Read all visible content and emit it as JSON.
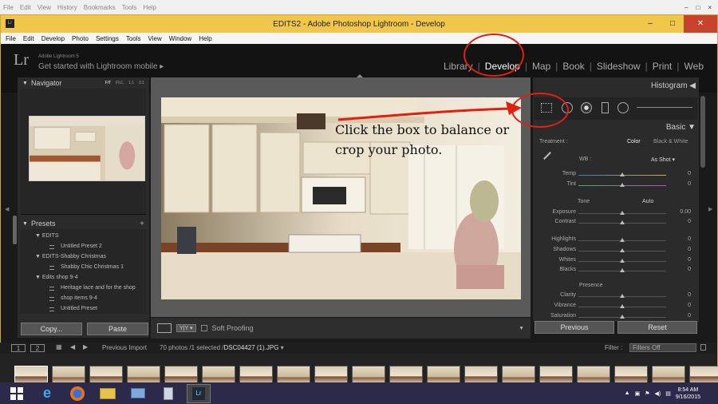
{
  "background_menu": [
    "File",
    "Edit",
    "View",
    "History",
    "Bookmarks",
    "Tools",
    "Help"
  ],
  "window": {
    "title": "EDITS2 - Adobe Photoshop Lightroom - Develop"
  },
  "menubar": [
    "File",
    "Edit",
    "Develop",
    "Photo",
    "Settings",
    "Tools",
    "View",
    "Window",
    "Help"
  ],
  "identity": {
    "logo": "Lr",
    "version": "Adobe Lightroom 5",
    "mobile": "Get started with Lightroom mobile"
  },
  "modules": [
    "Library",
    "Develop",
    "Map",
    "Book",
    "Slideshow",
    "Print",
    "Web"
  ],
  "active_module": "Develop",
  "navigator": {
    "title": "Navigator",
    "opts": [
      "FIT",
      "FILL",
      "1:1",
      "3:1"
    ]
  },
  "presets": {
    "title": "Presets",
    "items": [
      {
        "type": "folder",
        "label": "EDITS"
      },
      {
        "type": "item",
        "label": "Untitled Preset 2"
      },
      {
        "type": "folder",
        "label": "EDITS-Shabby Christmas"
      },
      {
        "type": "item",
        "label": "Shabby Chic Christmas 1"
      },
      {
        "type": "folder",
        "label": "Edits shop 9-4"
      },
      {
        "type": "item",
        "label": "Heritage lace and for the shop"
      },
      {
        "type": "item",
        "label": "shop items 9-4"
      },
      {
        "type": "item",
        "label": "Untitled Preset"
      }
    ]
  },
  "left_buttons": {
    "copy": "Copy...",
    "paste": "Paste"
  },
  "toolbar": {
    "soft_proofing": "Soft Proofing"
  },
  "annotation": "Click the box to balance or crop your photo.",
  "right": {
    "histogram": "Histogram",
    "basic": "Basic",
    "treatment_label": "Treatment :",
    "treatment_color": "Color",
    "treatment_bw": "Black & White",
    "wb_label": "WB :",
    "wb_value": "As Shot",
    "tone": "Tone",
    "auto": "Auto",
    "presence": "Presence",
    "sliders": [
      {
        "label": "Temp",
        "value": "0",
        "pos": 0.5
      },
      {
        "label": "Tint",
        "value": "0",
        "pos": 0.5
      },
      {
        "label": "Exposure",
        "value": "0.00",
        "pos": 0.5
      },
      {
        "label": "Contrast",
        "value": "0",
        "pos": 0.5
      },
      {
        "label": "Highlights",
        "value": "0",
        "pos": 0.5
      },
      {
        "label": "Shadows",
        "value": "0",
        "pos": 0.5
      },
      {
        "label": "Whites",
        "value": "0",
        "pos": 0.5
      },
      {
        "label": "Blacks",
        "value": "0",
        "pos": 0.5
      },
      {
        "label": "Clarity",
        "value": "0",
        "pos": 0.5
      },
      {
        "label": "Vibrance",
        "value": "0",
        "pos": 0.5
      },
      {
        "label": "Saturation",
        "value": "0",
        "pos": 0.5
      }
    ],
    "previous": "Previous",
    "reset": "Reset"
  },
  "filmstrip": {
    "pages": [
      "1",
      "2"
    ],
    "source": "Previous Import",
    "info": "70 photos /1 selected /",
    "file": "DSC04427 (1).JPG",
    "filter_label": "Filter :",
    "filter_value": "Filters Off"
  },
  "clock": {
    "time": "8:54 AM",
    "date": "9/16/2015"
  },
  "colors": {
    "accent": "#f0c74a",
    "annotation_red": "#e02010"
  }
}
